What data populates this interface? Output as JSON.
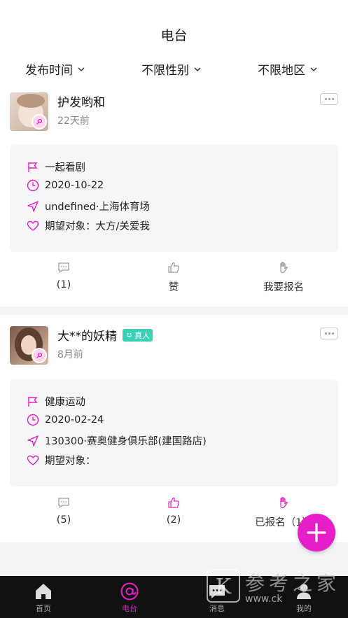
{
  "header": {
    "title": "电台"
  },
  "filters": [
    {
      "label": "发布时间"
    },
    {
      "label": "不限性别"
    },
    {
      "label": "不限地区"
    }
  ],
  "posts": [
    {
      "name": "护发哟和",
      "time": "22天前",
      "verified": false,
      "activity": "一起看剧",
      "date": "2020-10-22",
      "location": "undefined·上海体育场",
      "expect": "期望对象：大方/关爱我",
      "comments_label": "(1)",
      "like_label": "赞",
      "signup_label": "我要报名"
    },
    {
      "name": "大**的妖精",
      "time": "8月前",
      "verified": true,
      "verified_label": "真人",
      "activity": "健康运动",
      "date": "2020-02-24",
      "location": "130300·赛奥健身俱乐部(建国路店)",
      "expect": "期望对象：",
      "comments_label": "(5)",
      "like_label": "(2)",
      "signup_label": "已报名（1）"
    }
  ],
  "tabbar": [
    {
      "label": "首页",
      "icon": "home-icon"
    },
    {
      "label": "电台",
      "icon": "at-icon",
      "active": true
    },
    {
      "label": "消息",
      "icon": "message-icon"
    },
    {
      "label": "我的",
      "icon": "user-icon"
    }
  ],
  "watermark": {
    "text": "参考之家",
    "url": "www.ck"
  },
  "colors": {
    "accent": "#e61ec7",
    "verified": "#3ad1b8",
    "tabbar": "#111111"
  }
}
